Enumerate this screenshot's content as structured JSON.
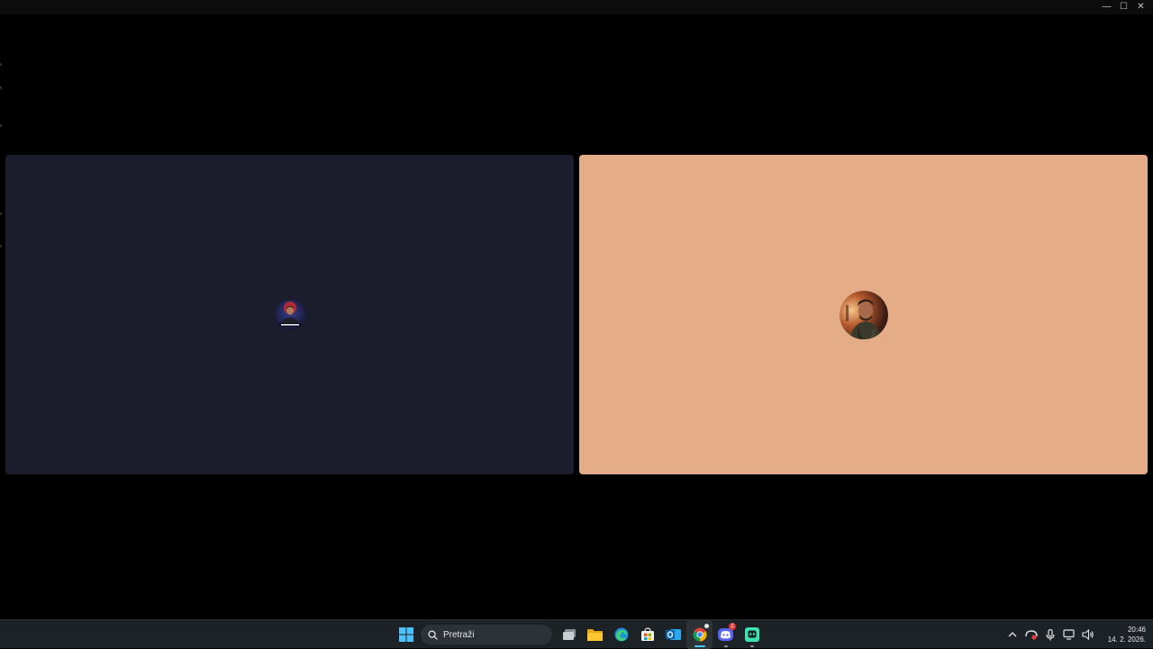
{
  "window": {
    "controls": {
      "minimize_glyph": "—",
      "maximize_glyph": "☐",
      "close_glyph": "✕"
    },
    "background": "#000000"
  },
  "call": {
    "participants": [
      {
        "tile_color": "#1b1d2c",
        "avatar_icon": "user-avatar-logo"
      },
      {
        "tile_color": "#e4ad88",
        "avatar_icon": "user-avatar-photo"
      }
    ]
  },
  "taskbar": {
    "search_placeholder": "Pretraži",
    "apps": [
      {
        "name": "start",
        "icon": "windows-icon"
      },
      {
        "name": "task-view",
        "icon": "task-view-icon"
      },
      {
        "name": "file-explorer",
        "icon": "folder-icon"
      },
      {
        "name": "edge",
        "icon": "edge-icon"
      },
      {
        "name": "store",
        "icon": "store-icon"
      },
      {
        "name": "outlook",
        "icon": "outlook-icon"
      },
      {
        "name": "chrome",
        "icon": "chrome-icon"
      },
      {
        "name": "discord",
        "icon": "discord-icon",
        "badge": "2"
      },
      {
        "name": "chat-app",
        "icon": "chat-app-icon"
      }
    ],
    "tray": {
      "icons": [
        "chevron-up-icon",
        "stop-recording-icon",
        "microphone-icon",
        "network-icon",
        "speaker-icon"
      ],
      "time": "20:46",
      "date": "14. 2. 2026."
    },
    "accent": "#4cc2ff"
  }
}
